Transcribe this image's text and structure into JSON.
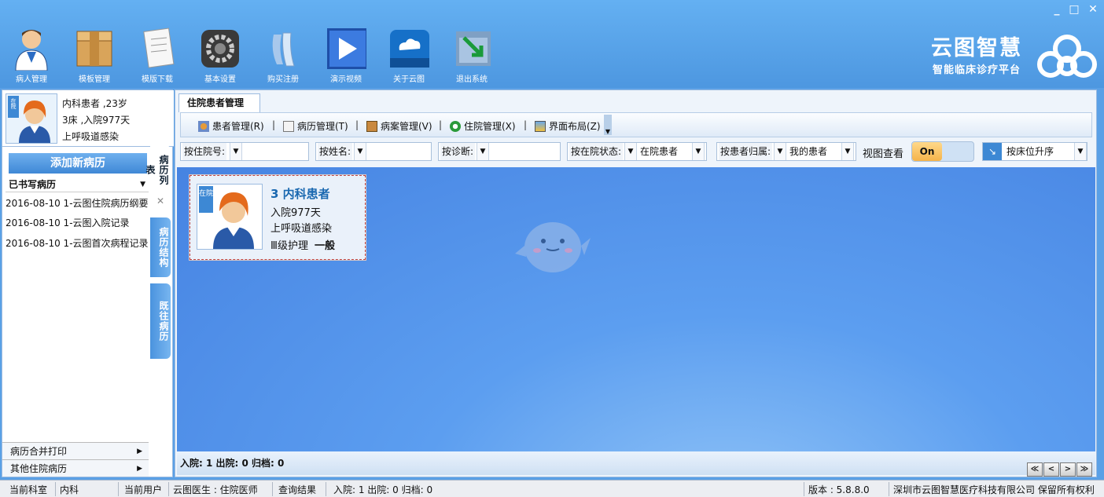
{
  "window": {
    "min": "_",
    "max": "□",
    "close": "✕"
  },
  "toolbar": [
    {
      "label": "病人管理",
      "icon": "doctor-icon"
    },
    {
      "label": "模板管理",
      "icon": "box-icon"
    },
    {
      "label": "模版下载",
      "icon": "document-icon"
    },
    {
      "label": "基本设置",
      "icon": "gear-icon"
    },
    {
      "label": "购买注册",
      "icon": "registration-icon"
    },
    {
      "label": "演示视频",
      "icon": "play-icon"
    },
    {
      "label": "关于云图",
      "icon": "cloud-icon"
    },
    {
      "label": "退出系统",
      "icon": "exit-icon"
    }
  ],
  "brand": {
    "name": "云图智慧",
    "tagline": "智能临床诊疗平台"
  },
  "patient": {
    "badge": "在院",
    "line1": "内科患者 ,23岁",
    "line2": "3床 ,入院977天",
    "line3": "上呼吸道感染"
  },
  "left": {
    "add_button": "添加新病历",
    "written_title": "已书写病历",
    "records": [
      "2016-08-10 1-云图住院病历纲要",
      "2016-08-10 1-云图入院记录",
      "2016-08-10 1-云图首次病程记录"
    ],
    "vtabs": [
      "病历列表",
      "病历结构",
      "既往病历"
    ],
    "footer": [
      "病历合并打印",
      "其他住院病历"
    ]
  },
  "main": {
    "tab": "住院患者管理",
    "menu": [
      {
        "label": "患者管理(R)",
        "icon": "patients-icon"
      },
      {
        "label": "病历管理(T)",
        "icon": "edit-record-icon"
      },
      {
        "label": "病案管理(V)",
        "icon": "case-icon"
      },
      {
        "label": "住院管理(X)",
        "icon": "recycle-icon"
      },
      {
        "label": "界面布局(Z)",
        "icon": "layout-icon"
      }
    ],
    "filters": {
      "admission_no": "按住院号:",
      "name": "按姓名:",
      "diagnosis": "按诊断:",
      "status_label": "按在院状态:",
      "status_value": "在院患者",
      "owner_label": "按患者归属:",
      "owner_value": "我的患者",
      "view_label": "视图查看",
      "view_toggle": "On",
      "sort_value": "按床位升序"
    },
    "card": {
      "badge": "在院",
      "title": "3 内科患者",
      "line1": "入院977天",
      "line2": "上呼吸道感染",
      "nursing": "Ⅲ级护理",
      "condition": "一般"
    },
    "stats": "入院: 1  出院: 0  归档: 0",
    "pager": [
      "≪",
      "<",
      ">",
      "≫"
    ]
  },
  "statusbar": {
    "dept_label": "当前科室",
    "dept": "内科",
    "user_label": "当前用户",
    "user": "云图医生 : 住院医师",
    "query_label": "查询结果",
    "query": "入院: 1  出院: 0  归档: 0",
    "version": "版本 : 5.8.8.0",
    "company": "深圳市云图智慧医疗科技有限公司 保留所有权利"
  },
  "colors": {
    "accent": "#4d97e0",
    "header_text": "#ffffff",
    "card_title": "#1a68b0",
    "toggle_on": "#f5b34a"
  }
}
